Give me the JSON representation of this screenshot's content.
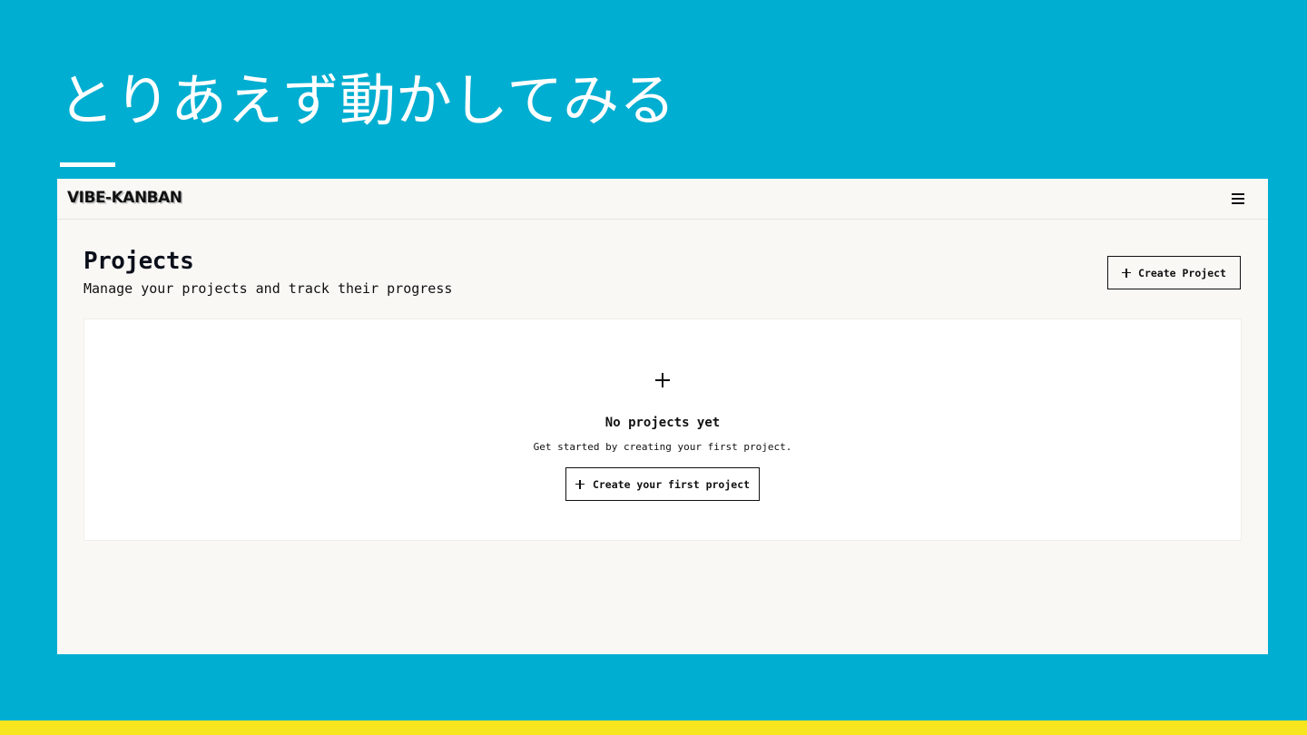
{
  "slide": {
    "title": "とりあえず動かしてみる",
    "colors": {
      "background": "#00aed1",
      "accent_bar": "#f7e51f",
      "text": "#ffffff"
    }
  },
  "app": {
    "logo": "VIBE-KANBAN",
    "menu_icon": "hamburger-menu-icon",
    "page": {
      "heading": "Projects",
      "subtitle": "Manage your projects and track their progress",
      "create_button": {
        "label": "Create Project",
        "icon": "plus-icon"
      }
    },
    "empty_state": {
      "icon": "plus-icon",
      "heading": "No projects yet",
      "text": "Get started by creating your first project.",
      "button": {
        "label": "Create your first project",
        "icon": "plus-icon"
      }
    }
  }
}
